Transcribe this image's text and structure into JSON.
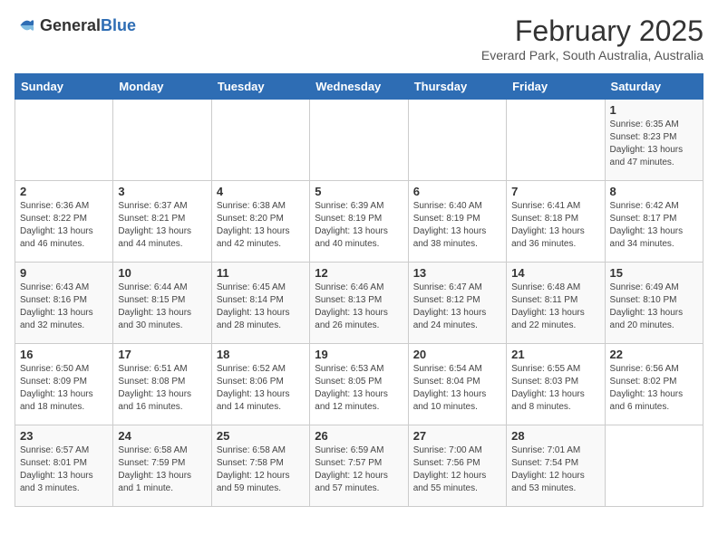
{
  "header": {
    "logo_general": "General",
    "logo_blue": "Blue",
    "title": "February 2025",
    "subtitle": "Everard Park, South Australia, Australia"
  },
  "weekdays": [
    "Sunday",
    "Monday",
    "Tuesday",
    "Wednesday",
    "Thursday",
    "Friday",
    "Saturday"
  ],
  "weeks": [
    [
      {
        "day": "",
        "info": ""
      },
      {
        "day": "",
        "info": ""
      },
      {
        "day": "",
        "info": ""
      },
      {
        "day": "",
        "info": ""
      },
      {
        "day": "",
        "info": ""
      },
      {
        "day": "",
        "info": ""
      },
      {
        "day": "1",
        "info": "Sunrise: 6:35 AM\nSunset: 8:23 PM\nDaylight: 13 hours and 47 minutes."
      }
    ],
    [
      {
        "day": "2",
        "info": "Sunrise: 6:36 AM\nSunset: 8:22 PM\nDaylight: 13 hours and 46 minutes."
      },
      {
        "day": "3",
        "info": "Sunrise: 6:37 AM\nSunset: 8:21 PM\nDaylight: 13 hours and 44 minutes."
      },
      {
        "day": "4",
        "info": "Sunrise: 6:38 AM\nSunset: 8:20 PM\nDaylight: 13 hours and 42 minutes."
      },
      {
        "day": "5",
        "info": "Sunrise: 6:39 AM\nSunset: 8:19 PM\nDaylight: 13 hours and 40 minutes."
      },
      {
        "day": "6",
        "info": "Sunrise: 6:40 AM\nSunset: 8:19 PM\nDaylight: 13 hours and 38 minutes."
      },
      {
        "day": "7",
        "info": "Sunrise: 6:41 AM\nSunset: 8:18 PM\nDaylight: 13 hours and 36 minutes."
      },
      {
        "day": "8",
        "info": "Sunrise: 6:42 AM\nSunset: 8:17 PM\nDaylight: 13 hours and 34 minutes."
      }
    ],
    [
      {
        "day": "9",
        "info": "Sunrise: 6:43 AM\nSunset: 8:16 PM\nDaylight: 13 hours and 32 minutes."
      },
      {
        "day": "10",
        "info": "Sunrise: 6:44 AM\nSunset: 8:15 PM\nDaylight: 13 hours and 30 minutes."
      },
      {
        "day": "11",
        "info": "Sunrise: 6:45 AM\nSunset: 8:14 PM\nDaylight: 13 hours and 28 minutes."
      },
      {
        "day": "12",
        "info": "Sunrise: 6:46 AM\nSunset: 8:13 PM\nDaylight: 13 hours and 26 minutes."
      },
      {
        "day": "13",
        "info": "Sunrise: 6:47 AM\nSunset: 8:12 PM\nDaylight: 13 hours and 24 minutes."
      },
      {
        "day": "14",
        "info": "Sunrise: 6:48 AM\nSunset: 8:11 PM\nDaylight: 13 hours and 22 minutes."
      },
      {
        "day": "15",
        "info": "Sunrise: 6:49 AM\nSunset: 8:10 PM\nDaylight: 13 hours and 20 minutes."
      }
    ],
    [
      {
        "day": "16",
        "info": "Sunrise: 6:50 AM\nSunset: 8:09 PM\nDaylight: 13 hours and 18 minutes."
      },
      {
        "day": "17",
        "info": "Sunrise: 6:51 AM\nSunset: 8:08 PM\nDaylight: 13 hours and 16 minutes."
      },
      {
        "day": "18",
        "info": "Sunrise: 6:52 AM\nSunset: 8:06 PM\nDaylight: 13 hours and 14 minutes."
      },
      {
        "day": "19",
        "info": "Sunrise: 6:53 AM\nSunset: 8:05 PM\nDaylight: 13 hours and 12 minutes."
      },
      {
        "day": "20",
        "info": "Sunrise: 6:54 AM\nSunset: 8:04 PM\nDaylight: 13 hours and 10 minutes."
      },
      {
        "day": "21",
        "info": "Sunrise: 6:55 AM\nSunset: 8:03 PM\nDaylight: 13 hours and 8 minutes."
      },
      {
        "day": "22",
        "info": "Sunrise: 6:56 AM\nSunset: 8:02 PM\nDaylight: 13 hours and 6 minutes."
      }
    ],
    [
      {
        "day": "23",
        "info": "Sunrise: 6:57 AM\nSunset: 8:01 PM\nDaylight: 13 hours and 3 minutes."
      },
      {
        "day": "24",
        "info": "Sunrise: 6:58 AM\nSunset: 7:59 PM\nDaylight: 13 hours and 1 minute."
      },
      {
        "day": "25",
        "info": "Sunrise: 6:58 AM\nSunset: 7:58 PM\nDaylight: 12 hours and 59 minutes."
      },
      {
        "day": "26",
        "info": "Sunrise: 6:59 AM\nSunset: 7:57 PM\nDaylight: 12 hours and 57 minutes."
      },
      {
        "day": "27",
        "info": "Sunrise: 7:00 AM\nSunset: 7:56 PM\nDaylight: 12 hours and 55 minutes."
      },
      {
        "day": "28",
        "info": "Sunrise: 7:01 AM\nSunset: 7:54 PM\nDaylight: 12 hours and 53 minutes."
      },
      {
        "day": "",
        "info": ""
      }
    ]
  ]
}
